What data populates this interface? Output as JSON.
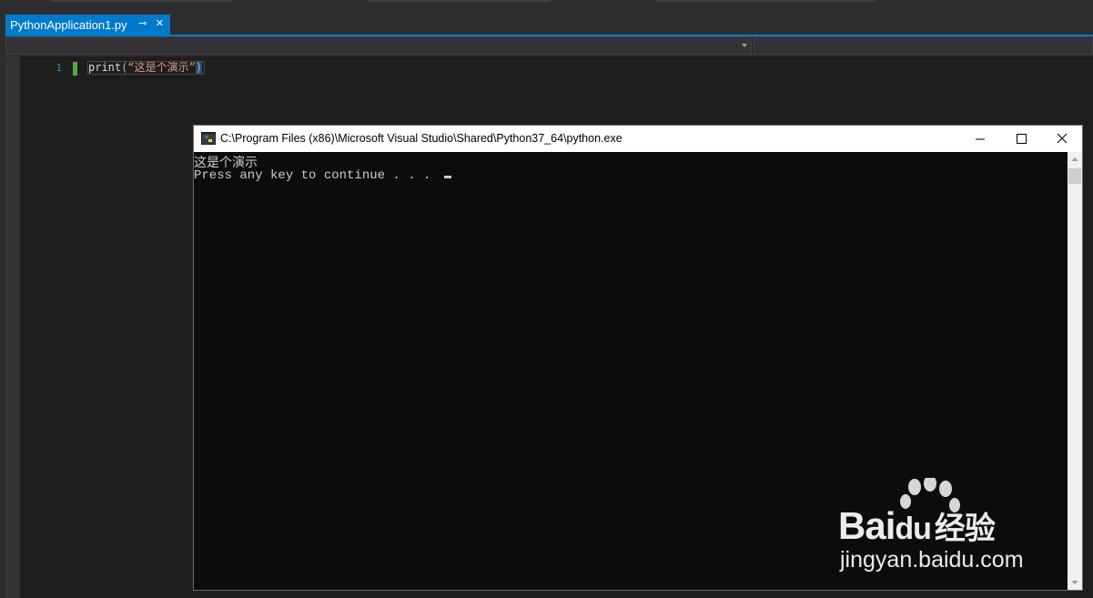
{
  "tab": {
    "title": "PythonApplication1.py",
    "pin_glyph": "⊸",
    "close_glyph": "×"
  },
  "editor": {
    "line_number": "1",
    "code": {
      "fn": "print",
      "open": "(",
      "string": "“这是个演示”",
      "close": ")"
    }
  },
  "console": {
    "title": "C:\\Program Files (x86)\\Microsoft Visual Studio\\Shared\\Python37_64\\python.exe",
    "output_line1": "这是个演示",
    "output_line2": "Press any key to continue . . . "
  },
  "watermark": {
    "brand_latin": "Bai",
    "brand_du": "du",
    "brand_cn": "经验",
    "url": "jingyan.baidu.com"
  },
  "colors": {
    "accent": "#007acc",
    "editor_bg": "#1e1e1e",
    "chrome_bg": "#2d2d30",
    "console_bg": "#0c0c0c",
    "string": "#d69d85",
    "line_number": "#2b91af"
  },
  "icons": {
    "pin": "pin-icon",
    "close": "close-icon",
    "python": "python-icon",
    "minimize": "minimize-icon",
    "maximize": "maximize-icon",
    "window_close": "window-close-icon",
    "caret": "chevron-down-icon"
  }
}
